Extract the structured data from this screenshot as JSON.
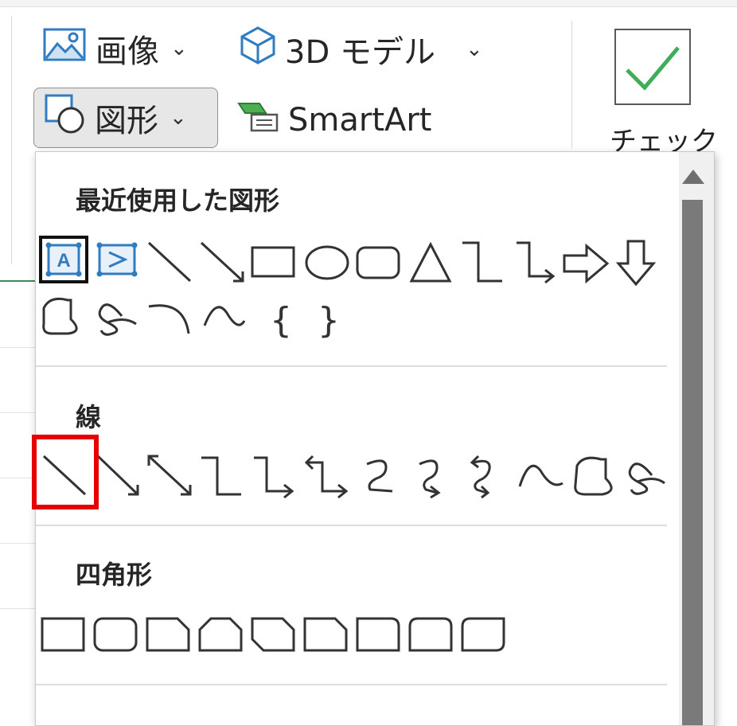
{
  "ribbon": {
    "picture_label": "画像",
    "model3d_label": "3D モデル",
    "shapes_label": "図形",
    "smartart_label": "SmartArt",
    "checkbox_label": "チェック"
  },
  "menu": {
    "sections": [
      {
        "title": "最近使用した図形"
      },
      {
        "title": "線"
      },
      {
        "title": "四角形"
      }
    ]
  },
  "icons": {
    "picture": "picture-icon",
    "model3d": "cube-icon",
    "shapes": "shapes-icon",
    "smartart": "smartart-icon",
    "checkbox": "checkmark-icon",
    "scroll_up": "scroll-up-arrow-icon"
  },
  "colors": {
    "highlight": "#e60000",
    "icon_blue": "#2f7cc0",
    "check_green": "#3fae5a"
  }
}
